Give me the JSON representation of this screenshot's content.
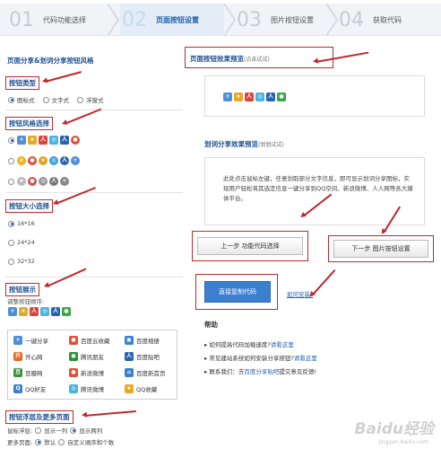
{
  "steps": [
    {
      "num": "01",
      "label": "代码功能选择"
    },
    {
      "num": "02",
      "label": "页面按钮设置"
    },
    {
      "num": "03",
      "label": "图片按钮设置"
    },
    {
      "num": "04",
      "label": "获取代码"
    }
  ],
  "left": {
    "title": "页面分享&划词分享按钮风格",
    "button_type": {
      "heading": "按钮类型",
      "options": [
        "图标式",
        "文字式",
        "浮窗式"
      ],
      "selected": 0
    },
    "button_style": {
      "heading": "按钮风格选择"
    },
    "button_size": {
      "heading": "按钮大小选择",
      "options": [
        "16*16",
        "24*24",
        "32*32"
      ],
      "selected": 0
    },
    "button_display": {
      "heading": "按钮展示",
      "order_label": "调整按钮顺序:"
    },
    "services": [
      [
        "一键分享",
        "百度云收藏",
        "百度相册"
      ],
      [
        "开心网",
        "腾讯朋友",
        "百度贴吧"
      ],
      [
        "豆瓣网",
        "新浪微博",
        "百度新首页"
      ],
      [
        "QQ好友",
        "腾讯微博",
        "QQ收藏"
      ]
    ],
    "float": {
      "heading": "按钮浮层及更多页面",
      "float_label": "鼠标浮层:",
      "float_options": [
        "显示一列",
        "显示两列"
      ],
      "float_selected": 1,
      "more_label": "更多页面:",
      "more_options": [
        "默认",
        "自定义顺序和个数"
      ],
      "more_selected": 0
    }
  },
  "right": {
    "preview_title": "页面按钮效果预览",
    "preview_hint": "(点击试试)",
    "word_title": "划词分享效果预览",
    "word_hint": "(划划试试)",
    "word_text": "此处点击鼠标左键，任意划取部分文字信息，即可显示划词分享图标，实现用户轻松将其选定信息一键分享到QQ空间、新浪微博、人人网等各大媒体平台。",
    "prev_button": "上一步 功能代码选择",
    "next_button": "下一步 图片按钮设置",
    "copy_button": "直接复制代码",
    "how_install": "如何安装?",
    "help_title": "帮助",
    "help": [
      {
        "text": "如何提高代码加载速度?",
        "link": "请看这里"
      },
      {
        "text": "常见建站系统如何安装分享按钮?",
        "link": "请看这里"
      },
      {
        "text": "联系我们：去",
        "link": "百度分享贴吧",
        "tail": "提交意见反馈!"
      }
    ]
  },
  "watermark": {
    "brand": "Baidu经验",
    "url": "jingyan.baidu.com"
  },
  "colors": {
    "accent": "#1e4f92",
    "copy_button": "#3a7fd0",
    "annotation": "#c0282d"
  }
}
